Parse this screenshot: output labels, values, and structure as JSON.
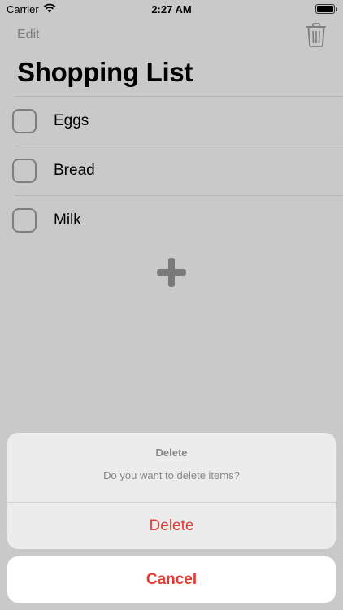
{
  "status_bar": {
    "carrier": "Carrier",
    "time": "2:27 AM"
  },
  "nav": {
    "edit_label": "Edit"
  },
  "title": "Shopping List",
  "items": [
    {
      "label": "Eggs",
      "checked": false
    },
    {
      "label": "Bread",
      "checked": false
    },
    {
      "label": "Milk",
      "checked": false
    }
  ],
  "icons": {
    "trash": "trash-icon",
    "add": "plus-icon",
    "wifi": "wifi-icon",
    "battery": "battery-icon"
  },
  "alert": {
    "title": "Delete",
    "message": "Do you want to delete items?",
    "delete_label": "Delete",
    "cancel_label": "Cancel"
  },
  "colors": {
    "background": "#c9c9c9",
    "destructive": "#e33b33",
    "muted": "#7d7d7d"
  }
}
